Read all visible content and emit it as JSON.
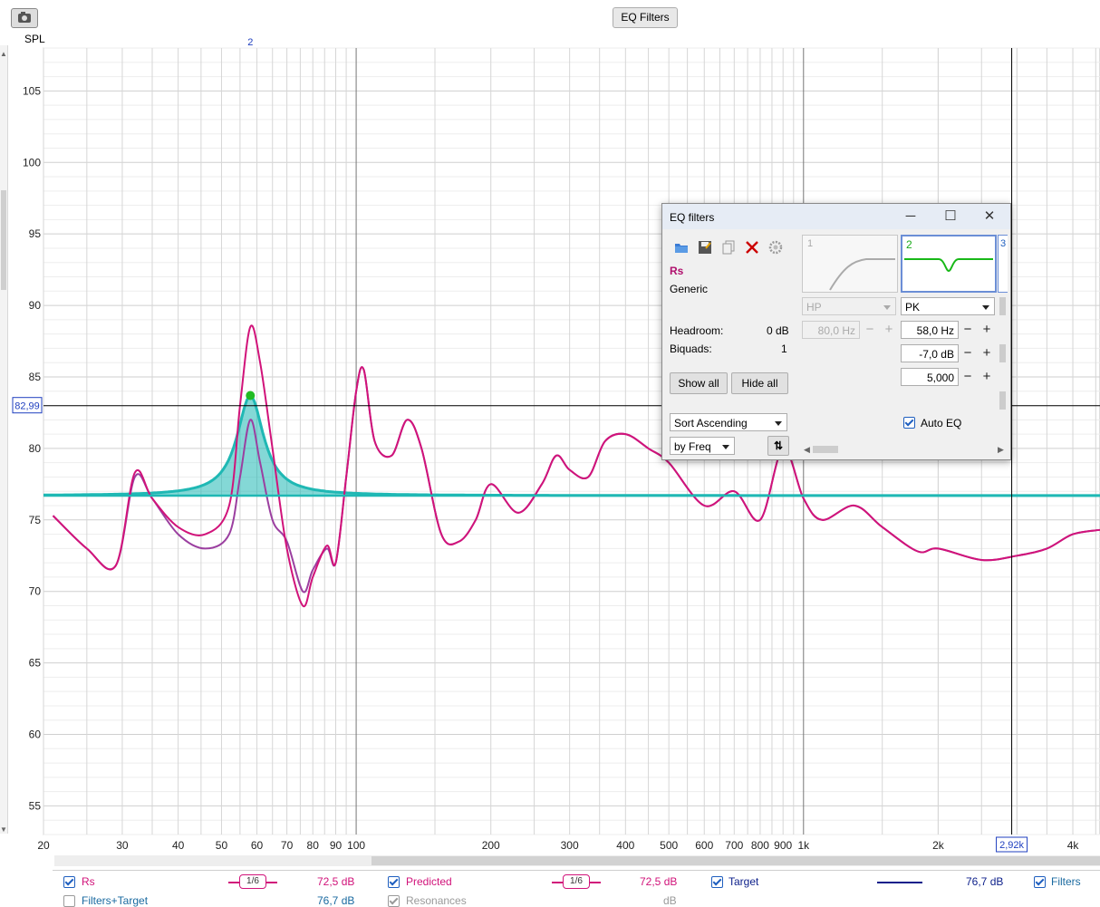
{
  "toolbar": {
    "eq_filters_button": "EQ Filters"
  },
  "graph": {
    "y_axis_title": "SPL",
    "y_ticks": [
      "105",
      "100",
      "95",
      "90",
      "85",
      "80",
      "75",
      "70",
      "65",
      "60",
      "55"
    ],
    "x_ticks": [
      "20",
      "30",
      "40",
      "50",
      "60",
      "70",
      "80",
      "90",
      "100",
      "200",
      "300",
      "400",
      "500",
      "600",
      "700",
      "800",
      "900",
      "1k",
      "2k",
      "4k"
    ],
    "cursor_y_readout": "82,99",
    "cursor_x_readout": "2,92k",
    "filter_marker_label": "2",
    "colors": {
      "measurement": "#d1137a",
      "filter": "#1fb8b4",
      "target": "#0c1f8a",
      "marker": "#22bb22"
    }
  },
  "chart_data": {
    "type": "line",
    "x_scale": "log",
    "xlabel": "",
    "ylabel": "SPL",
    "xlim": [
      20,
      4600
    ],
    "ylim": [
      53,
      108
    ],
    "series": [
      {
        "name": "Rs",
        "x": [
          21,
          25,
          29,
          32,
          35,
          40,
          46,
          52,
          55,
          58,
          61,
          65,
          70,
          76,
          80,
          86,
          90,
          95,
          100,
          104,
          110,
          120,
          130,
          140,
          155,
          170,
          185,
          200,
          230,
          260,
          280,
          300,
          330,
          360,
          400,
          450,
          500,
          600,
          700,
          800,
          900,
          1000,
          1100,
          1300,
          1500,
          1800,
          2000,
          2500,
          3000,
          3500,
          4000,
          4600
        ],
        "y": [
          75.3,
          73,
          71.8,
          78.3,
          76.5,
          74.5,
          74,
          76,
          83,
          88.5,
          86,
          80,
          73,
          69,
          71,
          73.2,
          72,
          78,
          84,
          85.5,
          80.5,
          79.5,
          82,
          80,
          74,
          73.5,
          75,
          77.5,
          75.5,
          77.5,
          79.5,
          78.5,
          78,
          80.5,
          81,
          80,
          79,
          76,
          77,
          75,
          80,
          76.5,
          75,
          76,
          74.5,
          72.8,
          73,
          72.2,
          72.5,
          73,
          74,
          74.3
        ]
      },
      {
        "name": "Predicted",
        "x": [
          21,
          25,
          29,
          32,
          35,
          40,
          46,
          52,
          55,
          58,
          61,
          65,
          70,
          76,
          80,
          86,
          90,
          95,
          100,
          104,
          110,
          120,
          130,
          140,
          155,
          170,
          185,
          200,
          230,
          260,
          280,
          300,
          330,
          360,
          400,
          450,
          500,
          600,
          700,
          800,
          900,
          1000,
          1100,
          1300,
          1500,
          1800,
          2000,
          2500,
          3000,
          3500,
          4000,
          4600
        ],
        "y": [
          75.3,
          73,
          71.8,
          78,
          76.5,
          74,
          73,
          74,
          78,
          82,
          79,
          75,
          73.5,
          70,
          71.5,
          73,
          72,
          78,
          84,
          85.5,
          80.5,
          79.5,
          82,
          80,
          74,
          73.5,
          75,
          77.5,
          75.5,
          77.5,
          79.5,
          78.5,
          78,
          80.5,
          81,
          80,
          79,
          76,
          77,
          75,
          80,
          76.5,
          75,
          76,
          74.5,
          72.8,
          73,
          72.2,
          72.5,
          73,
          74,
          74.3
        ]
      },
      {
        "name": "Filter 2",
        "type": "area",
        "fc_hz": 58.0,
        "gain_db": 7.0,
        "q": 5.0,
        "base_db": 76.7
      },
      {
        "name": "Target",
        "value": 76.7
      }
    ]
  },
  "eq_window": {
    "title": "EQ filters",
    "measurement_name": "Rs",
    "equaliser": "Generic",
    "headroom_label": "Headroom:",
    "headroom_value": "0 dB",
    "biquads_label": "Biquads:",
    "biquads_value": "1",
    "show_all": "Show all",
    "hide_all": "Hide all",
    "sort_order": "Sort Ascending",
    "sort_by": "by Freq",
    "auto_eq_label": "Auto EQ",
    "filters": [
      {
        "index": "1",
        "type": "HP",
        "freq": "80,0 Hz",
        "enabled": false
      },
      {
        "index": "2",
        "type": "PK",
        "freq": "58,0 Hz",
        "gain": "-7,0 dB",
        "q": "5,000",
        "enabled": true
      },
      {
        "index": "3"
      }
    ],
    "window_buttons": {
      "minimize": "─",
      "maximize": "☐",
      "close": "✕"
    }
  },
  "legend": {
    "rows": [
      [
        {
          "label": "Rs",
          "checked": true,
          "smoothing": "1/6",
          "value": "72,5 dB",
          "color": "#d1137a"
        },
        {
          "label": "Predicted",
          "checked": true,
          "smoothing": "1/6",
          "value": "72,5 dB",
          "color": "#d1137a"
        },
        {
          "label": "Target",
          "checked": true,
          "value": "76,7 dB",
          "color": "#0c1f8a"
        },
        {
          "label": "Filters",
          "checked": true,
          "color": "#1fb8b4"
        }
      ],
      [
        {
          "label": "Filters+Target",
          "checked": false,
          "value": "76,7 dB",
          "color": "#1a6aa0"
        },
        {
          "label": "Resonances",
          "checked": true,
          "value": "dB",
          "color": "#9a9a9a"
        }
      ]
    ]
  }
}
